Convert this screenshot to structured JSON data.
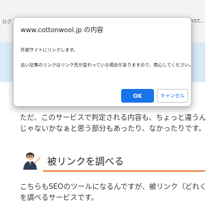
{
  "background_page": {
    "nav_left": "ログ",
    "nav_right": "YST...",
    "paragraph_lines": [
      "ただ、このサービスで判定される内容も、ちょっと違うん",
      "じゃないかなぁと思う部分もあったり、なかったりです。"
    ],
    "section_heading": "被リンクを調べる",
    "section_lines": [
      "こちらもSEOのツールになるんですが、被リンク（どれくらい",
      "を調べるサービスです。"
    ]
  },
  "dialog": {
    "title": "www.cottonwool.jp の内容",
    "message_line1": "外部サイトにリンクします。",
    "message_line2": "古い記事のリンクはリンク先が変わっている場合がありますので、用心してください。",
    "ok_label": "OK",
    "cancel_label": "キャンセル"
  },
  "colors": {
    "accent": "#1a73e8",
    "heading_underline": "#e97d34",
    "header_strip": "#d8ebf7"
  }
}
